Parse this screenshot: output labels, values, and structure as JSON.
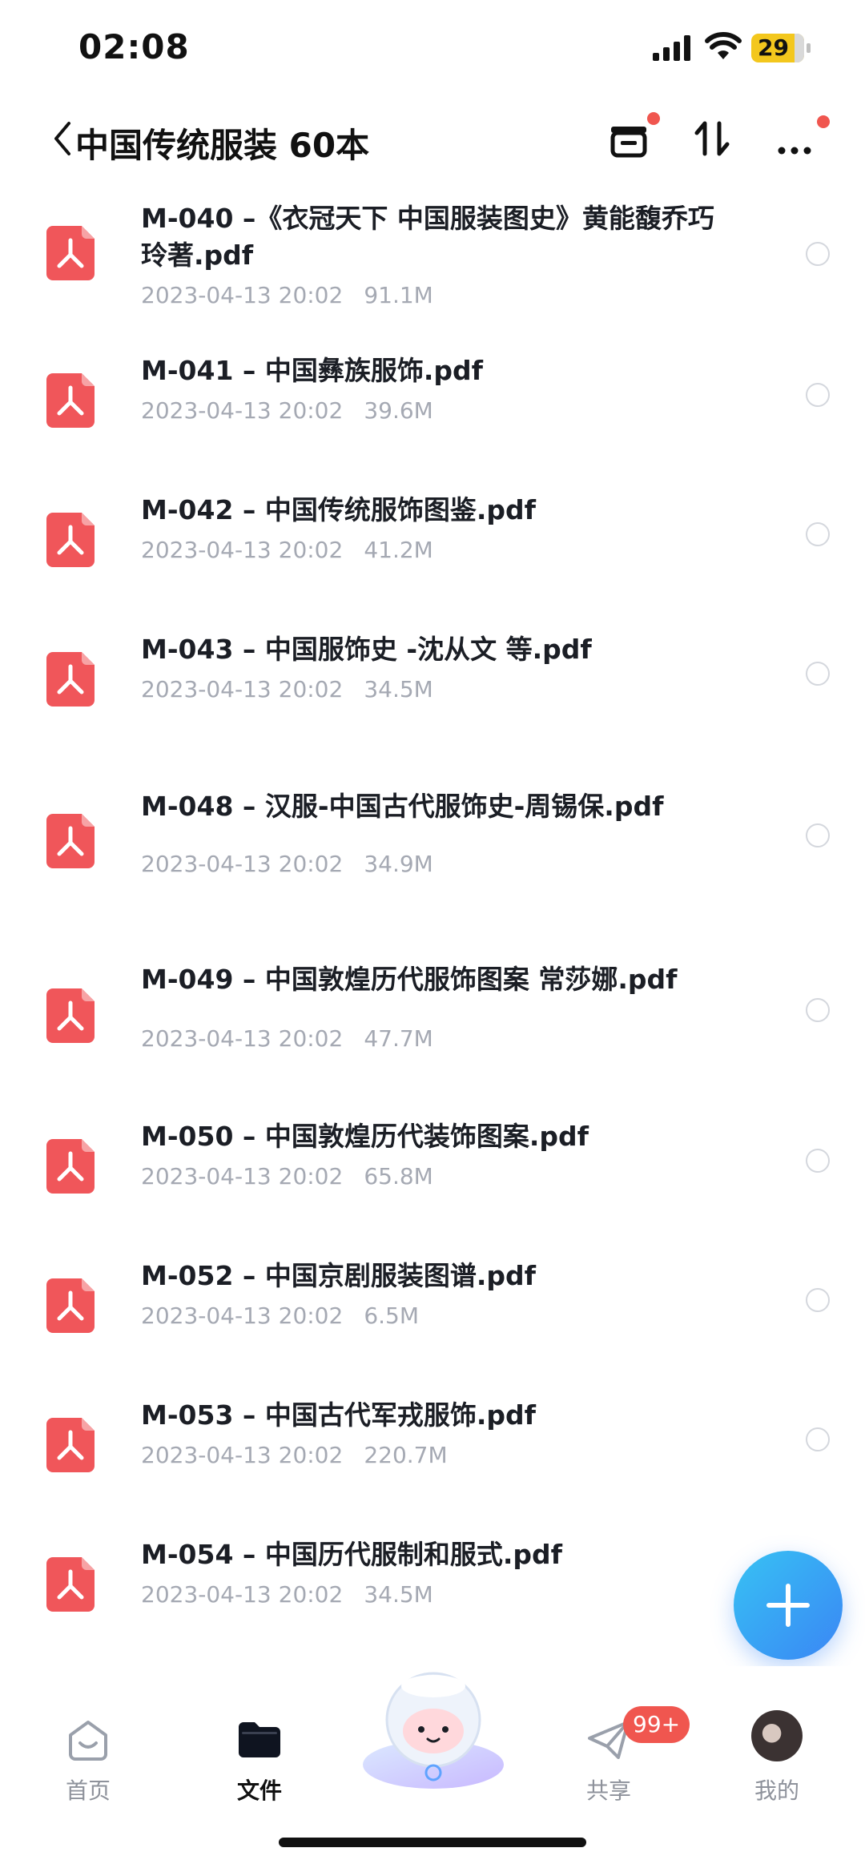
{
  "status_bar": {
    "time": "02:08",
    "battery": "29"
  },
  "header": {
    "title": "中国传统服装 60本"
  },
  "files": [
    {
      "name": "M-040 –《衣冠天下 中国服装图史》黄能馥乔巧玲著.pdf",
      "date": "2023-04-13 20:02",
      "size": "91.1M"
    },
    {
      "name": "M-041 – 中国彝族服饰.pdf",
      "date": "2023-04-13 20:02",
      "size": "39.6M"
    },
    {
      "name": "M-042 – 中国传统服饰图鉴.pdf",
      "date": "2023-04-13 20:02",
      "size": "41.2M"
    },
    {
      "name": "M-043 – 中国服饰史 -沈从文 等.pdf",
      "date": "2023-04-13 20:02",
      "size": "34.5M"
    },
    {
      "name": "M-048 – 汉服-中国古代服饰史-周锡保.pdf",
      "date": "2023-04-13 20:02",
      "size": "34.9M"
    },
    {
      "name": "M-049 – 中国敦煌历代服饰图案 常莎娜.pdf",
      "date": "2023-04-13 20:02",
      "size": "47.7M"
    },
    {
      "name": "M-050 – 中国敦煌历代装饰图案.pdf",
      "date": "2023-04-13 20:02",
      "size": "65.8M"
    },
    {
      "name": "M-052 – 中国京剧服装图谱.pdf",
      "date": "2023-04-13 20:02",
      "size": "6.5M"
    },
    {
      "name": "M-053 – 中国古代军戎服饰.pdf",
      "date": "2023-04-13 20:02",
      "size": "220.7M"
    },
    {
      "name": "M-054 – 中国历代服制和服式.pdf",
      "date": "2023-04-13 20:02",
      "size": "34.5M"
    }
  ],
  "tabbar": {
    "home": "首页",
    "files": "文件",
    "share": "共享",
    "share_badge": "99+",
    "mine": "我的"
  },
  "colors": {
    "accent": "#3a86f5",
    "pdf_red": "#f0565a",
    "badge_red": "#f0564f"
  }
}
